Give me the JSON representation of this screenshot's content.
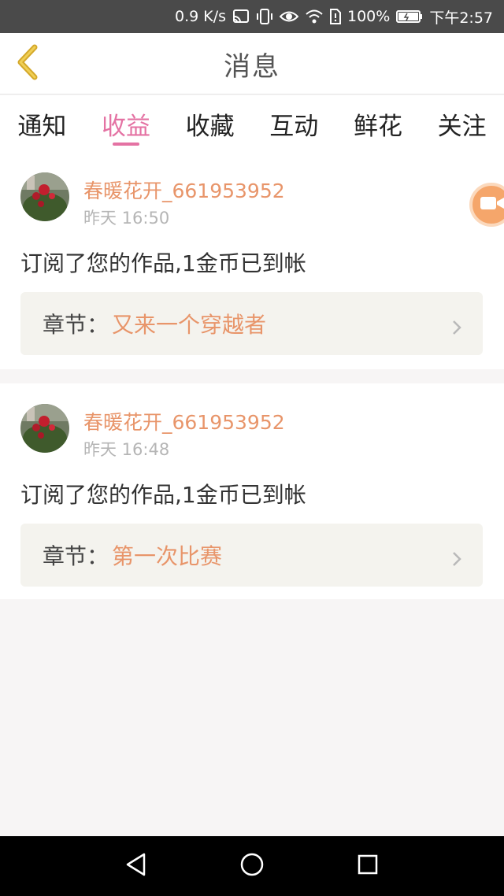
{
  "status_bar": {
    "speed": "0.9 K/s",
    "battery": "100%",
    "time": "下午2:57"
  },
  "header": {
    "title": "消息",
    "back_icon": "chevron-left-icon"
  },
  "tabs": [
    {
      "label": "通知",
      "active": false
    },
    {
      "label": "收益",
      "active": true
    },
    {
      "label": "收藏",
      "active": false
    },
    {
      "label": "互动",
      "active": false
    },
    {
      "label": "鲜花",
      "active": false
    },
    {
      "label": "关注",
      "active": false
    }
  ],
  "messages": [
    {
      "username": "春暖花开_661953952",
      "time": "昨天 16:50",
      "text": "订阅了您的作品,1金币已到帐",
      "chapter_label": "章节：",
      "chapter_title": "又来一个穿越者"
    },
    {
      "username": "春暖花开_661953952",
      "time": "昨天 16:48",
      "text": "订阅了您的作品,1金币已到帐",
      "chapter_label": "章节：",
      "chapter_title": "第一次比赛"
    }
  ],
  "colors": {
    "accent_pink": "#e472a3",
    "accent_orange": "#e8956a",
    "status_bar": "#4a4a4a"
  },
  "icons": [
    "cast-icon",
    "vibrate-icon",
    "eye-icon",
    "wifi-icon",
    "sim-icon",
    "battery-icon",
    "video-camera-icon",
    "back-triangle-icon",
    "home-circle-icon",
    "recents-square-icon"
  ]
}
